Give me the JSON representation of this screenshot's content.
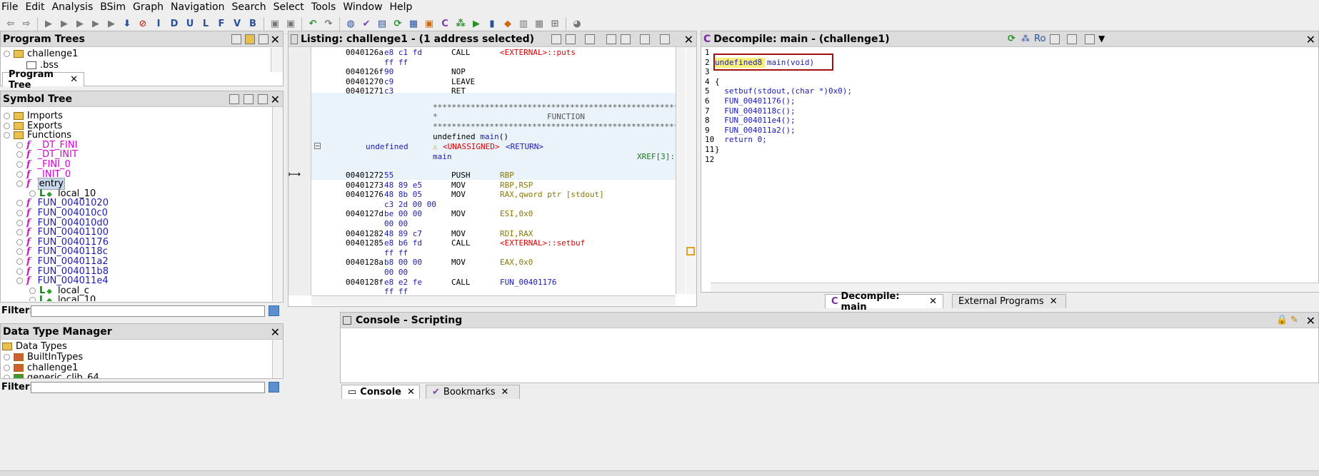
{
  "menu": [
    "File",
    "Edit",
    "Analysis",
    "BSim",
    "Graph",
    "Navigation",
    "Search",
    "Select",
    "Tools",
    "Window",
    "Help"
  ],
  "program_trees": {
    "title": "Program Trees",
    "root": "challenge1",
    "child": ".bss",
    "tab": "Program Tree"
  },
  "symbol_tree": {
    "title": "Symbol Tree",
    "items": [
      {
        "label": "Imports",
        "kind": "folder",
        "indent": 0
      },
      {
        "label": "Exports",
        "kind": "folder",
        "indent": 0
      },
      {
        "label": "Functions",
        "kind": "folder",
        "indent": 0
      },
      {
        "label": "_DT_FINI",
        "kind": "fn",
        "indent": 1,
        "color": "magenta"
      },
      {
        "label": "_DT_INIT",
        "kind": "fn",
        "indent": 1,
        "color": "magenta"
      },
      {
        "label": "_FINI_0",
        "kind": "fn",
        "indent": 1,
        "color": "magenta"
      },
      {
        "label": "_INIT_0",
        "kind": "fn",
        "indent": 1,
        "color": "magenta"
      },
      {
        "label": "entry",
        "kind": "fn",
        "indent": 1,
        "color": "black",
        "selected": true
      },
      {
        "label": "local_10",
        "kind": "local",
        "indent": 2
      },
      {
        "label": "FUN_00401020",
        "kind": "fn",
        "indent": 1,
        "color": "blue"
      },
      {
        "label": "FUN_004010c0",
        "kind": "fn",
        "indent": 1,
        "color": "blue"
      },
      {
        "label": "FUN_004010d0",
        "kind": "fn",
        "indent": 1,
        "color": "blue"
      },
      {
        "label": "FUN_00401100",
        "kind": "fn",
        "indent": 1,
        "color": "blue"
      },
      {
        "label": "FUN_00401176",
        "kind": "fn",
        "indent": 1,
        "color": "blue"
      },
      {
        "label": "FUN_0040118c",
        "kind": "fn",
        "indent": 1,
        "color": "blue"
      },
      {
        "label": "FUN_004011a2",
        "kind": "fn",
        "indent": 1,
        "color": "blue"
      },
      {
        "label": "FUN_004011b8",
        "kind": "fn",
        "indent": 1,
        "color": "blue"
      },
      {
        "label": "FUN_004011e4",
        "kind": "fn",
        "indent": 1,
        "color": "blue"
      },
      {
        "label": "local_c",
        "kind": "local",
        "indent": 2
      },
      {
        "label": "local_10",
        "kind": "local",
        "indent": 2
      }
    ],
    "filter_label": "Filter:"
  },
  "data_type_manager": {
    "title": "Data Type Manager",
    "items": [
      "Data Types",
      "BuiltInTypes",
      "challenge1",
      "generic_clib_64"
    ],
    "filter_label": "Filter:"
  },
  "listing": {
    "title": "Listing:  challenge1 - (1 address selected)",
    "rows": [
      {
        "addr": "0040126a",
        "bytes": "e8 c1 fd",
        "mn": "CALL",
        "op": "<EXTERNAL>::puts",
        "opcls": "ext"
      },
      {
        "addr": "",
        "bytes": "ff ff",
        "mn": "",
        "op": "",
        "opcls": ""
      },
      {
        "addr": "0040126f",
        "bytes": "90",
        "mn": "NOP",
        "op": "",
        "opcls": ""
      },
      {
        "addr": "00401270",
        "bytes": "c9",
        "mn": "LEAVE",
        "op": "",
        "opcls": ""
      },
      {
        "addr": "00401271",
        "bytes": "c3",
        "mn": "RET",
        "op": "",
        "opcls": ""
      }
    ],
    "func_header": {
      "stars": "**************************************************************",
      "function_label": "FUNCTION",
      "signature_prefix": "undefined ",
      "signature_name": "main",
      "signature_suffix": "()",
      "ret_type": "undefined",
      "unassigned": "<UNASSIGNED>",
      "return_label": "<RETURN>",
      "label": "main",
      "xref": "XREF[3]:"
    },
    "rows2": [
      {
        "addr": "00401272",
        "bytes": "55",
        "mn": "PUSH",
        "op": "RBP",
        "opcls": "op"
      },
      {
        "addr": "00401273",
        "bytes": "48 89 e5",
        "mn": "MOV",
        "op": "RBP,RSP",
        "opcls": "op"
      },
      {
        "addr": "00401276",
        "bytes": "48 8b 05",
        "mn": "MOV",
        "op": "RAX,qword ptr [stdout]",
        "opcls": "mixed"
      },
      {
        "addr": "",
        "bytes": "c3 2d 00 00",
        "mn": "",
        "op": "",
        "opcls": ""
      },
      {
        "addr": "0040127d",
        "bytes": "be 00 00",
        "mn": "MOV",
        "op": "ESI,0x0",
        "opcls": "op"
      },
      {
        "addr": "",
        "bytes": "00 00",
        "mn": "",
        "op": "",
        "opcls": ""
      },
      {
        "addr": "00401282",
        "bytes": "48 89 c7",
        "mn": "MOV",
        "op": "RDI,RAX",
        "opcls": "op"
      },
      {
        "addr": "00401285",
        "bytes": "e8 b6 fd",
        "mn": "CALL",
        "op": "<EXTERNAL>::setbuf",
        "opcls": "ext"
      },
      {
        "addr": "",
        "bytes": "ff ff",
        "mn": "",
        "op": "",
        "opcls": ""
      },
      {
        "addr": "0040128a",
        "bytes": "b8 00 00",
        "mn": "MOV",
        "op": "EAX,0x0",
        "opcls": "op"
      },
      {
        "addr": "",
        "bytes": "00 00",
        "mn": "",
        "op": "",
        "opcls": ""
      },
      {
        "addr": "0040128f",
        "bytes": "e8 e2 fe",
        "mn": "CALL",
        "op": "FUN_00401176",
        "opcls": "lbl"
      },
      {
        "addr": "",
        "bytes": "ff ff",
        "mn": "",
        "op": "",
        "opcls": ""
      }
    ]
  },
  "decompile": {
    "title": "Decompile: main - (challenge1)",
    "ro": "Ro",
    "lines": [
      {
        "n": "1",
        "code": ""
      },
      {
        "n": "2",
        "code": "undefined8 main(void)"
      },
      {
        "n": "3",
        "code": ""
      },
      {
        "n": "4",
        "code": "{"
      },
      {
        "n": "5",
        "code": "  setbuf(stdout,(char *)0x0);"
      },
      {
        "n": "6",
        "code": "  FUN_00401176();"
      },
      {
        "n": "7",
        "code": "  FUN_0040118c();"
      },
      {
        "n": "8",
        "code": "  FUN_004011e4();"
      },
      {
        "n": "9",
        "code": "  FUN_004011a2();"
      },
      {
        "n": "10",
        "code": "  return 0;"
      },
      {
        "n": "11",
        "code": "}"
      },
      {
        "n": "12",
        "code": ""
      }
    ],
    "tabs": [
      "Decompile: main",
      "External Programs"
    ]
  },
  "console": {
    "title": "Console - Scripting",
    "tabs": [
      "Console",
      "Bookmarks"
    ]
  },
  "colors": {
    "accent": "#1a1ab8",
    "highlight_box": "#a01010",
    "magenta": "#d400d4",
    "external": "#dd0000"
  }
}
